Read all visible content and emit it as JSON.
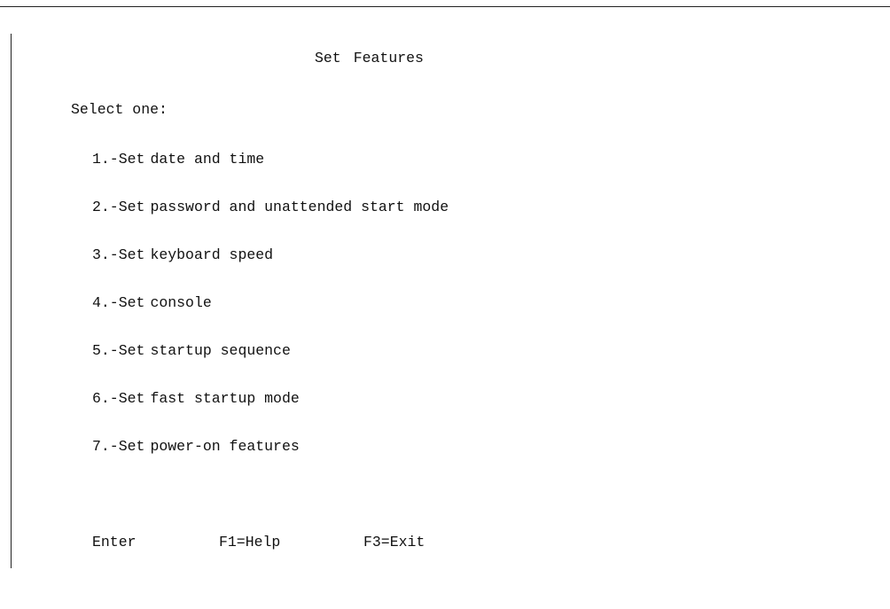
{
  "screen": {
    "title_word1": "Set",
    "title_word2": "Features",
    "prompt": "Select one:"
  },
  "menu": {
    "items": [
      {
        "number": "1.-",
        "label": "Set",
        "text": "date and time"
      },
      {
        "number": "2.-",
        "label": "Set",
        "text": "password and unattended start mode"
      },
      {
        "number": "3.-",
        "label": "Set",
        "text": "keyboard speed"
      },
      {
        "number": "4.-",
        "label": "Set",
        "text": "console"
      },
      {
        "number": "5.-",
        "label": "Set",
        "text": "startup sequence"
      },
      {
        "number": "6.-",
        "label": "Set",
        "text": "fast startup mode"
      },
      {
        "number": "7.-",
        "label": "Set",
        "text": "power-on features"
      }
    ]
  },
  "function_keys": {
    "enter": "Enter",
    "help": "F1=Help",
    "exit": "F3=Exit"
  }
}
